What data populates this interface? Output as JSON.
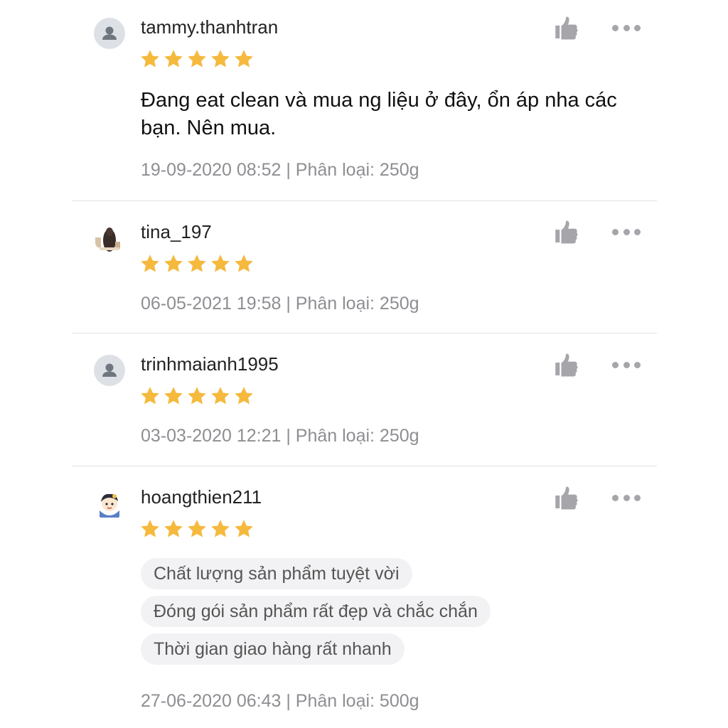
{
  "reviews": [
    {
      "username": "tammy.thanhtran",
      "avatar": "default-user-icon",
      "rating": 5,
      "comment": "Đang eat clean và mua ng liệu ở đây, ổn áp nha các bạn. Nên mua.",
      "meta": "19-09-2020 08:52 | Phân loại: 250g"
    },
    {
      "username": "tina_197",
      "avatar": "photo-avatar-long-hair",
      "rating": 5,
      "meta": "06-05-2021 19:58 | Phân loại: 250g"
    },
    {
      "username": "trinhmaianh1995",
      "avatar": "default-user-icon",
      "rating": 5,
      "meta": "03-03-2020 12:21 | Phân loại: 250g"
    },
    {
      "username": "hoangthien211",
      "avatar": "cartoon-avatar",
      "rating": 5,
      "tags": [
        "Chất lượng sản phẩm tuyệt vời",
        "Đóng gói sản phẩm rất đẹp và chắc chắn",
        "Thời gian giao hàng rất nhanh"
      ],
      "meta": "27-06-2020 06:43 | Phân loại: 500g"
    }
  ],
  "colors": {
    "star": "#f5b93d",
    "icon_gray": "#a5a5aa",
    "meta_text": "#8e8e93",
    "tag_bg": "#f2f2f4",
    "divider": "#e1e1e4"
  },
  "icons": {
    "like": "thumbs-up-icon",
    "more": "more-options-icon"
  }
}
